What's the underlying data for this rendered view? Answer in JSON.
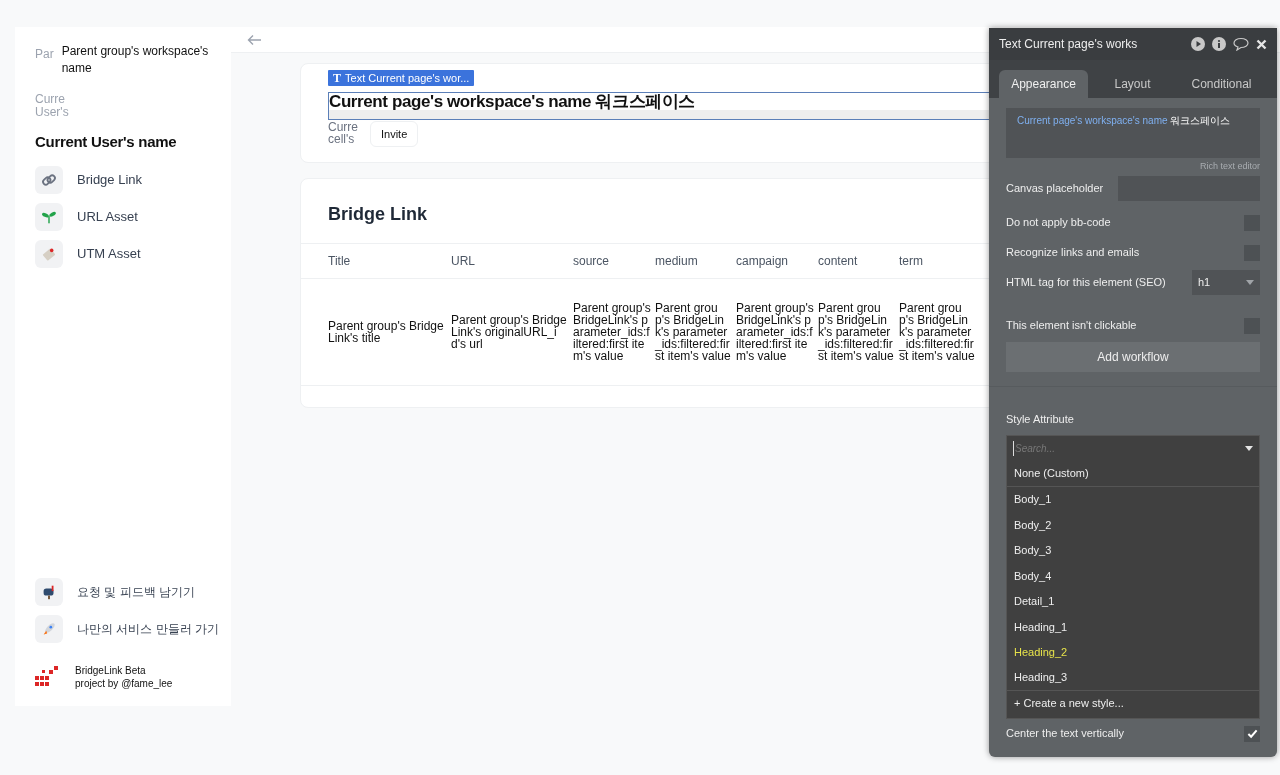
{
  "sidebar": {
    "workspace": {
      "avatar_text": "Par",
      "name": "Parent group's workspace's name"
    },
    "user": {
      "avatar_text": "Curre User's",
      "name": "Current User's name"
    },
    "items": [
      {
        "kind": "link",
        "label": "Bridge Link"
      },
      {
        "kind": "sprout",
        "label": "URL Asset"
      },
      {
        "kind": "tag",
        "label": "UTM Asset"
      }
    ],
    "bottom_items": [
      {
        "kind": "mailbox",
        "label": "요청 및 피드백 남기기"
      },
      {
        "kind": "rocket",
        "label": "나만의 서비스 만들러 가기"
      }
    ],
    "brand": {
      "name": "BridgeLink Beta",
      "credit": "project by @fame_lee"
    }
  },
  "workspace_card": {
    "element_tag": "Text Current page's wor...",
    "element_tag_icon": "T",
    "heading": "Current page's workspace's name 워크스페이스",
    "member_text": "Curre cell's",
    "invite_button": "Invite"
  },
  "table_card": {
    "title": "Bridge Link",
    "columns": [
      "Title",
      "URL",
      "source",
      "medium",
      "campaign",
      "content",
      "term"
    ],
    "rows": [
      [
        "Parent group's BridgeLink's title",
        "Parent group's BridgeLink's originalURL_id's url",
        "Parent group's BridgeLink's parameter_ids:filtered:first item's value",
        "Parent group's BridgeLink's parameter_ids:filtered:first item's value",
        "Parent group's BridgeLink's parameter_ids:filtered:first item's value",
        "Parent group's BridgeLink's parameter_ids:filtered:first item's value",
        "Parent group's BridgeLink's parameter_ids:filtered:first item's value"
      ]
    ]
  },
  "property_panel": {
    "title": "Text Current page's works",
    "tabs": [
      {
        "label": "Appearance",
        "selected": true
      },
      {
        "label": "Layout",
        "selected": false
      },
      {
        "label": "Conditional",
        "selected": false
      }
    ],
    "content_dynamic": "Current page's workspace's name",
    "content_static": " 워크스페이스",
    "rich_text_link": "Rich text editor",
    "fields": [
      {
        "kind": "input",
        "label": "Canvas placeholder"
      },
      {
        "kind": "checkbox",
        "label": "Do not apply bb-code",
        "checked": false
      },
      {
        "kind": "checkbox",
        "label": "Recognize links and emails",
        "checked": false
      },
      {
        "kind": "select",
        "label": "HTML tag for this element (SEO)",
        "value": "h1"
      },
      {
        "kind": "checkbox",
        "label": "This element isn't clickable",
        "checked": false
      }
    ],
    "add_workflow": "Add workflow",
    "style_label": "Style Attribute",
    "style_dropdown": {
      "placeholder": "Search...",
      "items": [
        {
          "label": "None (Custom)",
          "selected": false,
          "divider_after": true
        },
        {
          "label": "Body_1",
          "selected": false,
          "divider_after": false
        },
        {
          "label": "Body_2",
          "selected": false,
          "divider_after": false
        },
        {
          "label": "Body_3",
          "selected": false,
          "divider_after": false
        },
        {
          "label": "Body_4",
          "selected": false,
          "divider_after": false
        },
        {
          "label": "Detail_1",
          "selected": false,
          "divider_after": false
        },
        {
          "label": "Heading_1",
          "selected": false,
          "divider_after": false
        },
        {
          "label": "Heading_2",
          "selected": true,
          "divider_after": false
        },
        {
          "label": "Heading_3",
          "selected": false,
          "divider_after": true
        }
      ],
      "create": "+ Create a new style..."
    },
    "center_vertically": {
      "label": "Center the text vertically",
      "checked": true
    }
  }
}
